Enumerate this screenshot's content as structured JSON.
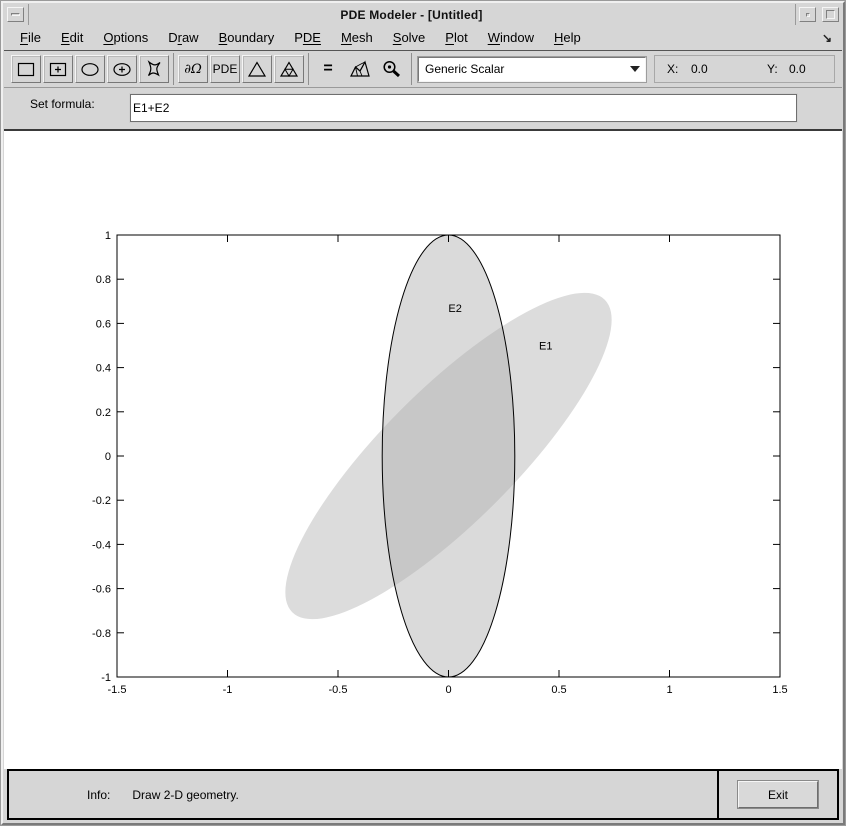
{
  "window": {
    "title": "PDE Modeler - [Untitled]",
    "controls": {
      "menu_button": "window-menu",
      "minimize": "minimize",
      "maximize": "maximize"
    }
  },
  "menu": {
    "items": [
      {
        "label": "File",
        "u_start": 0,
        "u_len": 1
      },
      {
        "label": "Edit",
        "u_start": 0,
        "u_len": 1
      },
      {
        "label": "Options",
        "u_start": 0,
        "u_len": 1
      },
      {
        "label": "Draw",
        "u_start": 1,
        "u_len": 1
      },
      {
        "label": "Boundary",
        "u_start": 0,
        "u_len": 1
      },
      {
        "label": "PDE",
        "u_start": 1,
        "u_len": 2
      },
      {
        "label": "Mesh",
        "u_start": 0,
        "u_len": 1
      },
      {
        "label": "Solve",
        "u_start": 0,
        "u_len": 1
      },
      {
        "label": "Plot",
        "u_start": 0,
        "u_len": 1
      },
      {
        "label": "Window",
        "u_start": 0,
        "u_len": 1
      },
      {
        "label": "Help",
        "u_start": 0,
        "u_len": 1
      }
    ],
    "overflow_arrow": "↘"
  },
  "toolbar": {
    "buttons": [
      {
        "name": "draw-rectangle",
        "icon": "rect",
        "style": "raised",
        "sep_after": false
      },
      {
        "name": "draw-rectangle-centered",
        "icon": "rect-plus",
        "style": "raised",
        "sep_after": false
      },
      {
        "name": "draw-ellipse",
        "icon": "ellipse",
        "style": "raised",
        "sep_after": false
      },
      {
        "name": "draw-ellipse-centered",
        "icon": "ellipse-plus",
        "style": "raised",
        "sep_after": false
      },
      {
        "name": "draw-polygon",
        "icon": "polygon",
        "style": "raised",
        "sep_after": true
      },
      {
        "name": "boundary-mode",
        "icon": "text",
        "text": "∂Ω",
        "text_class": "boundary",
        "style": "raised",
        "sep_after": false
      },
      {
        "name": "pde-mode",
        "icon": "text",
        "text": "PDE",
        "text_class": "pde",
        "style": "raised",
        "sep_after": false
      },
      {
        "name": "initialize-mesh",
        "icon": "triangle",
        "style": "raised",
        "sep_after": false
      },
      {
        "name": "refine-mesh",
        "icon": "triangle-refined",
        "style": "raised",
        "sep_after": true
      },
      {
        "name": "solve-pde",
        "icon": "text",
        "text": "=",
        "text_class": "solve",
        "style": "flat",
        "sep_after": false
      },
      {
        "name": "plot-solution",
        "icon": "mesh-surface",
        "style": "flat",
        "sep_after": false
      },
      {
        "name": "zoom",
        "icon": "magnifier",
        "style": "flat",
        "sep_after": true
      }
    ],
    "application_dropdown": {
      "value": "Generic Scalar"
    },
    "coords": {
      "x_label": "X:",
      "x_value": "0.0",
      "y_label": "Y:",
      "y_value": "0.0"
    }
  },
  "formula": {
    "label": "Set formula:",
    "value": "E1+E2"
  },
  "statusbar": {
    "info_label": "Info:",
    "message": "Draw 2-D geometry.",
    "exit_label": "Exit"
  },
  "colors": {
    "chrome_bg": "#d6d6d6",
    "canvas_bg": "#ffffff",
    "shape_fill": "#dcdcdc",
    "shape_overlay_fill": "rgba(173,173,173,0.45)",
    "shape_stroke": "#000000",
    "axis_color": "#000000"
  },
  "chart_data": {
    "type": "geometry-plot",
    "title": "",
    "xlabel": "",
    "ylabel": "",
    "xlim": [
      -1.5,
      1.5
    ],
    "ylim": [
      -1,
      1
    ],
    "x_ticks": [
      -1.5,
      -1,
      -0.5,
      0,
      0.5,
      1,
      1.5
    ],
    "x_tick_labels": [
      "-1.5",
      "-1",
      "-0.5",
      "0",
      "0.5",
      "1",
      "1.5"
    ],
    "y_ticks": [
      -1,
      -0.8,
      -0.6,
      -0.4,
      -0.2,
      0,
      0.2,
      0.4,
      0.6,
      0.8,
      1
    ],
    "y_tick_labels": [
      "-1",
      "-0.8",
      "-0.6",
      "-0.4",
      "-0.2",
      "0",
      "0.2",
      "0.4",
      "0.6",
      "0.8",
      "1"
    ],
    "grid": false,
    "box": true,
    "shapes": [
      {
        "id": "E1",
        "shape": "ellipse",
        "center": [
          0,
          0
        ],
        "semi_axis_a": 1.0,
        "semi_axis_b": 0.3,
        "rotation_deg": 45,
        "fill": "#dcdcdc",
        "stroke": "none",
        "label": "E1",
        "label_pos": [
          0.44,
          0.5
        ]
      },
      {
        "id": "E2",
        "shape": "ellipse",
        "center": [
          0,
          0
        ],
        "semi_axis_a": 0.3,
        "semi_axis_b": 1.0,
        "rotation_deg": 0,
        "fill": "rgba(173,173,173,0.45)",
        "stroke": "#000000",
        "label": "E2",
        "label_pos": [
          0.03,
          0.67
        ]
      }
    ]
  }
}
